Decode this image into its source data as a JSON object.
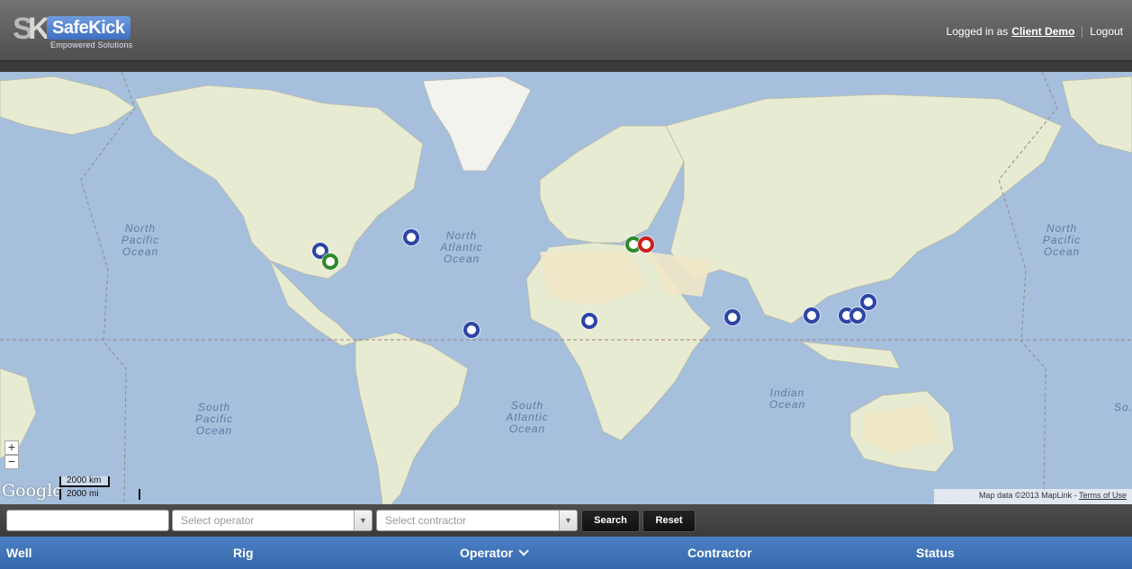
{
  "header": {
    "logo_word": "SafeKick",
    "logo_tagline": "Empowered Solutions",
    "logged_in_prefix": "Logged in as",
    "user_name": "Client Demo",
    "logout_label": "Logout"
  },
  "map": {
    "ocean_labels": [
      "North Pacific Ocean",
      "North Atlantic Ocean",
      "North Pacific Ocean",
      "South Pacific Ocean",
      "South Atlantic Ocean",
      "Indian Ocean",
      "So..."
    ],
    "marker_colors": {
      "blue": "#2e45a6",
      "green": "#2f8a2a",
      "red": "#cc2020"
    },
    "zoom_in_label": "+",
    "zoom_out_label": "−",
    "google_label": "Google",
    "scale_km": "2000 km",
    "scale_mi": "2000 mi",
    "attribution": "Map data ©2013 MapLink - ",
    "terms_label": "Terms of Use"
  },
  "filters": {
    "search_placeholder": "",
    "operator_placeholder": "Select operator",
    "contractor_placeholder": "Select contractor",
    "search_button": "Search",
    "reset_button": "Reset"
  },
  "table": {
    "columns": [
      "Well",
      "Rig",
      "Operator",
      "Contractor",
      "Status"
    ],
    "sorted_column": "Operator"
  }
}
